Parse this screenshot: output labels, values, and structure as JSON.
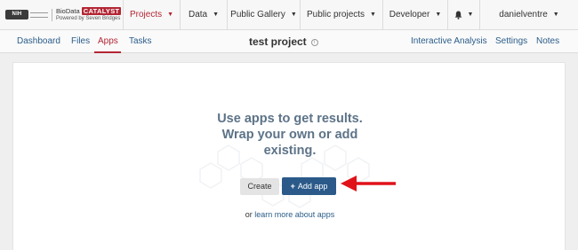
{
  "brand": {
    "logo_text": "NIH",
    "name_prefix": "BioData",
    "name_highlight": "CATALYST",
    "tagline": "Powered by Seven Bridges"
  },
  "topnav": {
    "items": [
      {
        "label": "Projects",
        "active": true
      },
      {
        "label": "Data",
        "active": false
      },
      {
        "label": "Public Gallery",
        "active": false
      },
      {
        "label": "Public projects",
        "active": false
      },
      {
        "label": "Developer",
        "active": false
      }
    ],
    "bell_icon": "bell-icon",
    "user": "danielventre"
  },
  "subnav": {
    "tabs": [
      "Dashboard",
      "Files",
      "Apps",
      "Tasks"
    ],
    "active_tab": "Apps",
    "project_title": "test project",
    "right_links": [
      "Interactive Analysis",
      "Settings",
      "Notes"
    ]
  },
  "empty_state": {
    "headline_lines": [
      "Use apps to get results.",
      "Wrap your own or add",
      "existing."
    ],
    "create_label": "Create",
    "add_label": "Add app",
    "learn_prefix": "or",
    "learn_link": "learn more about apps"
  },
  "colors": {
    "accent_red": "#b32634",
    "primary_blue": "#2b5a8a",
    "link_blue": "#2a5d8a",
    "headline_slate": "#5d7388",
    "annotation_arrow": "#e0121a"
  }
}
